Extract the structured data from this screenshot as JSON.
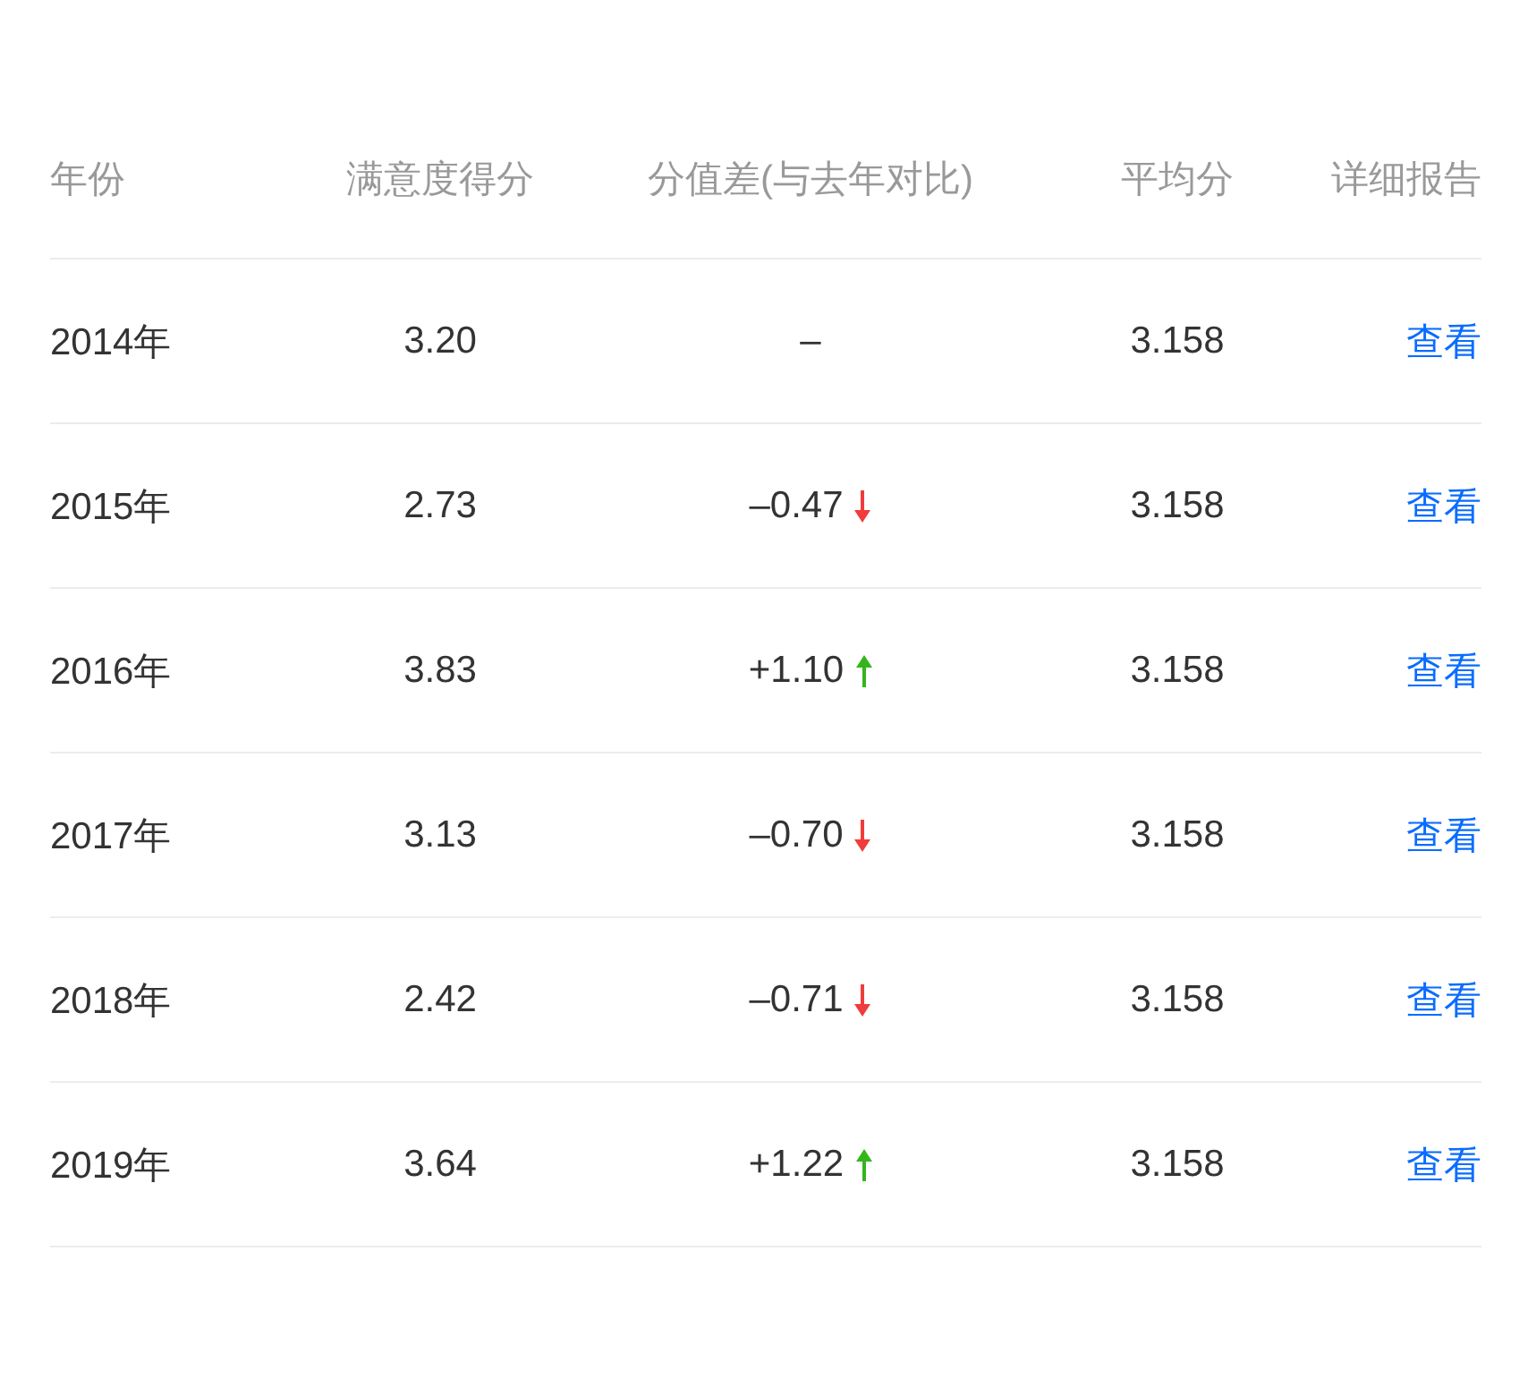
{
  "table": {
    "columns": [
      "年份",
      "满意度得分",
      "分值差(与去年对比)",
      "平均分",
      "详细报告"
    ],
    "rows": [
      {
        "year": "2014年",
        "score": "3.20",
        "diff": {
          "text": "–",
          "kind": "flat"
        },
        "average": "3.158",
        "report": "查看"
      },
      {
        "year": "2015年",
        "score": "2.73",
        "diff": {
          "text": "–0.47",
          "kind": "down"
        },
        "average": "3.158",
        "report": "查看"
      },
      {
        "year": "2016年",
        "score": "3.83",
        "diff": {
          "text": "+1.10",
          "kind": "up"
        },
        "average": "3.158",
        "report": "查看"
      },
      {
        "year": "2017年",
        "score": "3.13",
        "diff": {
          "text": "–0.70",
          "kind": "down"
        },
        "average": "3.158",
        "report": "查看"
      },
      {
        "year": "2018年",
        "score": "2.42",
        "diff": {
          "text": "–0.71",
          "kind": "down"
        },
        "average": "3.158",
        "report": "查看"
      },
      {
        "year": "2019年",
        "score": "3.64",
        "diff": {
          "text": "+1.22",
          "kind": "up"
        },
        "average": "3.158",
        "report": "查看"
      }
    ]
  }
}
